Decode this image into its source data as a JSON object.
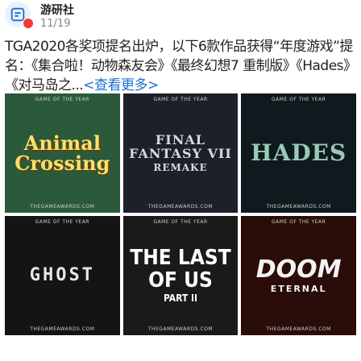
{
  "post": {
    "author": "游研社",
    "date": "11/19",
    "text": "TGA2020各奖项提名出炉，以下6款作品获得“年度游戏”提名：《集合啦！动物森友会》《最终幻想7 重制版》《Hades》《对马岛之...",
    "more_label": "<查看更多>",
    "avatar_icon": "gamepad-icon",
    "badge_color": "#f03c3c",
    "link_color": "#1a6fd6"
  },
  "images": [
    {
      "top": "GAME OF THE YEAR",
      "title": "Animal Crossing",
      "bottom": "THEGAMEAWARDS.COM"
    },
    {
      "top": "GAME OF THE YEAR",
      "title": "FINAL FANTASY VII",
      "sub": "REMAKE",
      "bottom": "THEGAMEAWARDS.COM"
    },
    {
      "top": "GAME OF THE YEAR",
      "title": "HADES",
      "bottom": "THEGAMEAWARDS.COM"
    },
    {
      "top": "GAME OF THE YEAR",
      "title": "GHOST",
      "bottom": "THEGAMEAWARDS.COM"
    },
    {
      "top": "GAME OF THE YEAR",
      "title": "THE LAST OF US",
      "sub": "PART II",
      "bottom": "THEGAMEAWARDS.COM"
    },
    {
      "top": "GAME OF THE YEAR",
      "title": "DOOM",
      "sub": "ETERNAL",
      "bottom": "THEGAMEAWARDS.COM"
    }
  ]
}
